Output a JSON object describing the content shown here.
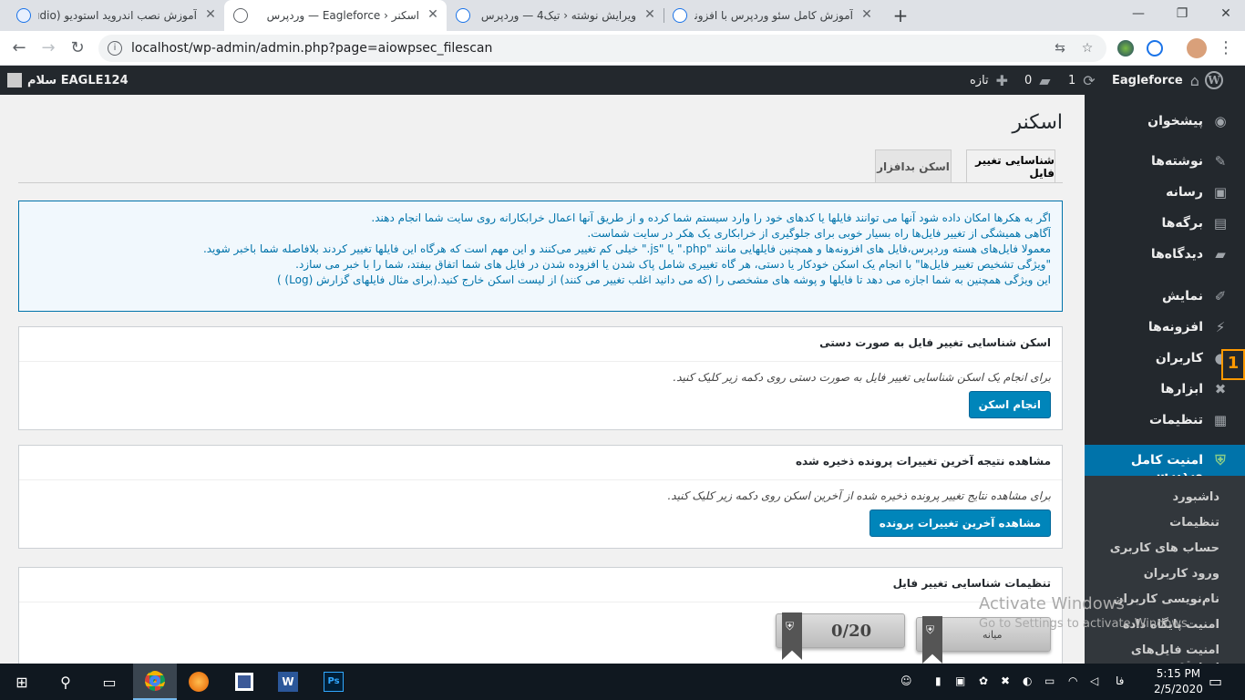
{
  "browser": {
    "tabs": [
      {
        "title": "آموزش نصب اندروید استودیو (udio",
        "active": false
      },
      {
        "title": "اسکنر ‹ Eagleforce — وردپرس",
        "active": true
      },
      {
        "title": "ویرایش نوشته ‹ تیک4 — وردپرس",
        "active": false
      },
      {
        "title": "آموزش کامل سئو وردپرس با افزونه",
        "active": false
      }
    ],
    "new_tab": "+",
    "window_buttons": {
      "minimize": "—",
      "maximize": "❐",
      "close": "✕"
    },
    "nav": {
      "back": "←",
      "forward": "→",
      "reload": "↻"
    },
    "url": "localhost/wp-admin/admin.php?page=aiowpsec_filescan",
    "info_icon": "i"
  },
  "admin_bar": {
    "wp_logo_icon": "wordpress-icon",
    "site_name": "Eagleforce",
    "updates_count": "1",
    "comments_count": "0",
    "new_label": "تازه",
    "greeting": "سلام EAGLE124"
  },
  "admin_menu": {
    "items": [
      {
        "label": "پیشخوان",
        "icon": "dashboard-icon",
        "glyph": "◉"
      },
      {
        "label": "نوشته‌ها",
        "icon": "pin-icon",
        "glyph": "✎"
      },
      {
        "label": "رسانه",
        "icon": "media-icon",
        "glyph": "▣"
      },
      {
        "label": "برگه‌ها",
        "icon": "pages-icon",
        "glyph": "▤"
      },
      {
        "label": "دیدگاه‌ها",
        "icon": "comments-icon",
        "glyph": "▰"
      },
      {
        "label": "نمایش",
        "icon": "appearance-icon",
        "glyph": "✐"
      },
      {
        "label": "افزونه‌ها",
        "icon": "plugins-icon",
        "glyph": "⚡"
      },
      {
        "label": "کاربران",
        "icon": "users-icon",
        "glyph": "●"
      },
      {
        "label": "ابزارها",
        "icon": "tools-icon",
        "glyph": "✖"
      },
      {
        "label": "تنظیمات",
        "icon": "settings-icon",
        "glyph": "▦"
      },
      {
        "label": "امنیت کامل وردپرس",
        "icon": "shield-icon",
        "glyph": "⛨"
      }
    ],
    "submenu": [
      "داشبورد",
      "تنظیمات",
      "حساب های کاربری",
      "ورود کاربران",
      "نام‌نویسی کاربران",
      "امنیت پایگاه داده",
      "امنیت فایل‌های سیستم"
    ]
  },
  "page": {
    "title": "اسکنر",
    "tabs": [
      "شناسایی تغییر فایل",
      "اسکن بدافزار"
    ],
    "notice_lines": [
      "اگر به هکرها امکان داده شود آنها می توانند فایلها یا کدهای خود را وارد سیستم شما کرده و از طریق آنها اعمال خرابکارانه روی سایت شما انجام دهند.",
      "آگاهی همیشگی از تغییر فایل‌ها راه بسیار خوبی برای جلوگیری از خرابکاری یک هکر در سایت شماست.",
      "معمولا فایل‌های هسته وردپرس،فایل های افزونه‌ها و همچنین فایلهایی مانند \"php.\" یا \"js.\" خیلی کم تغییر می‌کنند و این مهم است که هرگاه این فایلها تغییر کردند بلافاصله شما باخبر شوید.",
      "\"ویژگی تشخیص تغییر فایل‌ها\" با انجام یک اسکن خودکار یا دستی، هر گاه تغییری شامل پاک شدن یا افزوده شدن در فایل های شما اتفاق بیفتد، شما را با خبر می سازد.",
      "این ویژگی همچنین به شما اجازه می دهد تا فایلها و پوشه های مشخصی را (که می دانید اغلب تغییر می کنند) از لیست اسکن خارج کنید.(برای مثال فایلهای گزارش (Log) )"
    ],
    "box1": {
      "heading": "اسکن شناسایی تغییر فایل به صورت دستی",
      "desc": "برای انجام یک اسکن شناسایی تغییر فایل به صورت دستی روی دکمه زیر کلیک کنید.",
      "button": "انجام اسکن"
    },
    "box2": {
      "heading": "مشاهده نتیجه آخرین تغییرات پرونده ذخیره شده",
      "desc": "برای مشاهده نتایج تغییر پرونده ذخیره شده از آخرین اسکن روی دکمه زیر کلیک کنید.",
      "button": "مشاهده آخرین تغییرات پرونده"
    },
    "box3": {
      "heading": "تنظیمات شناسایی تغییر فایل",
      "points": "0/20",
      "level": "میانه"
    }
  },
  "watermark": {
    "line1": "Activate Windows",
    "line2": "Go to Settings to activate Windows."
  },
  "side_gadget": "1",
  "taskbar": {
    "apps": [
      "start-icon",
      "search-icon",
      "task-view-icon",
      "chrome-icon",
      "firefox-icon",
      "app-icon",
      "word-icon",
      "photoshop-icon"
    ],
    "lang": "فا",
    "time": "5:15 PM",
    "date": "2/5/2020"
  }
}
